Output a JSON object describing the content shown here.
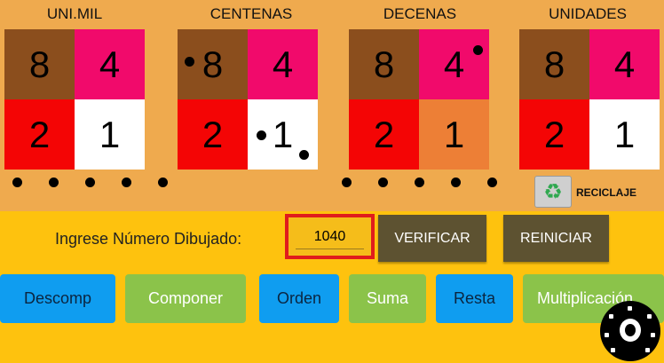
{
  "columns": [
    {
      "title": "UNI.MIL",
      "cells": [
        "8",
        "4",
        "2",
        "1"
      ]
    },
    {
      "title": "CENTENAS",
      "cells": [
        "8",
        "4",
        "2",
        "1"
      ]
    },
    {
      "title": "DECENAS",
      "cells": [
        "8",
        "4",
        "2",
        "1"
      ]
    },
    {
      "title": "UNIDADES",
      "cells": [
        "8",
        "4",
        "2",
        "1"
      ]
    }
  ],
  "recycle": {
    "label": "RECICLAJE",
    "icon": "recycle-icon"
  },
  "input_row": {
    "prompt": "Ingrese Número Dibujado:",
    "value": "1040",
    "verify_label": "VERIFICAR",
    "reset_label": "REINICIAR"
  },
  "buttons": [
    "Descomp",
    "Componer",
    "Orden",
    "Suma",
    "Resta",
    "Multiplicación"
  ],
  "camera_icon": "camera-icon",
  "colors": {
    "brown": "#8b4e1d",
    "pink": "#f10a6b",
    "red": "#f40505",
    "white": "#ffffff",
    "orange": "#ed7f36",
    "blue": "#0f9df0",
    "green": "#8bc34a",
    "dark_button": "#5d5231",
    "background": "#fec20e",
    "top_panel": "#efaa4e",
    "highlight": "#e01c1c"
  }
}
